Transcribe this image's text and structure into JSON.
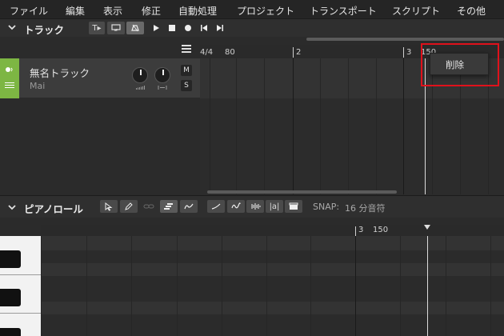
{
  "menu": [
    "ファイル",
    "編集",
    "表示",
    "修正",
    "自動処理",
    "プロジェクト",
    "トランスポート",
    "スクリプト",
    "その他"
  ],
  "track_section": {
    "title": "トラック",
    "toolbar": {
      "t_button": "T▸",
      "play_icon": "play-icon",
      "stop_icon": "stop-icon",
      "record_icon": "record-icon",
      "rewind_icon": "rewind-icon",
      "forward_icon": "forward-icon"
    },
    "ruler": {
      "time_signature": "4/4",
      "tempo": "80",
      "bar2": "2",
      "bar3": "3",
      "tempo2": "150"
    },
    "track": {
      "name": "無名トラック",
      "singer": "Mai",
      "mute": "M",
      "solo": "S",
      "color": "#7db643"
    }
  },
  "context_menu": {
    "delete_label": "削除"
  },
  "piano_section": {
    "title": "ピアノロール",
    "lyrics_button": "|a|",
    "snap_label": "SNAP:",
    "snap_value": "16 分音符",
    "ruler": {
      "bar3": "3",
      "tempo": "150"
    }
  },
  "colors": {
    "accent_green": "#7db643",
    "highlight_red": "#e0111b"
  }
}
